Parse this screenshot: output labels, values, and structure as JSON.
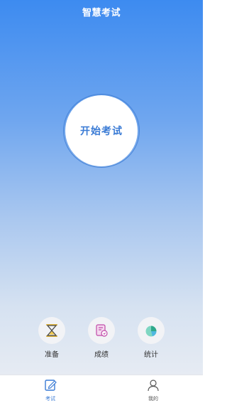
{
  "header": {
    "title": "智慧考试"
  },
  "main": {
    "start_button_label": "开始考试"
  },
  "features": [
    {
      "label": "准备",
      "icon": "hourglass-icon"
    },
    {
      "label": "成绩",
      "icon": "score-report-icon"
    },
    {
      "label": "统计",
      "icon": "pie-chart-icon"
    }
  ],
  "tabbar": [
    {
      "label": "考试",
      "icon": "edit-icon",
      "active": true
    },
    {
      "label": "我的",
      "icon": "user-icon",
      "active": false
    }
  ],
  "colors": {
    "accent": "#3a7bd5",
    "gradient_top": "#3d8bf0",
    "gradient_bottom": "#e6ebf3"
  }
}
